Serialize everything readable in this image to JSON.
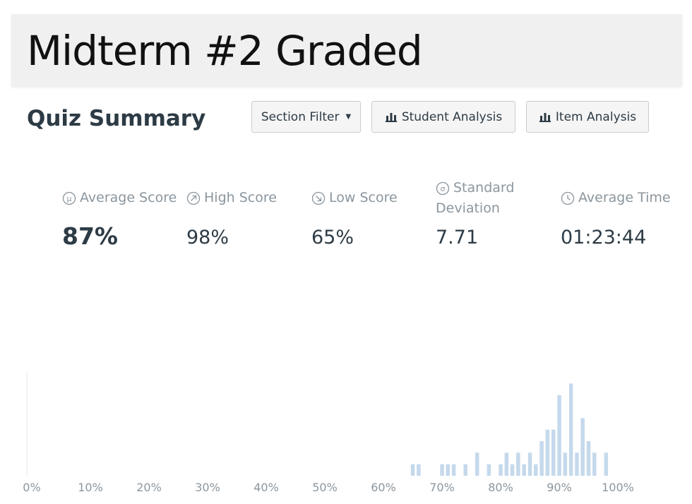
{
  "slide": {
    "title": "Midterm #2 Graded"
  },
  "quiz": {
    "heading": "Quiz Summary",
    "buttons": {
      "section_filter": "Section Filter",
      "student_analysis": "Student Analysis",
      "item_analysis": "Item Analysis"
    },
    "icons": {
      "section_filter": "caret-down-icon",
      "student_analysis": "bar-chart-icon",
      "item_analysis": "bar-chart-icon"
    }
  },
  "stats": {
    "average_score": {
      "label": "Average Score",
      "value": "87%",
      "icon": "mu-icon"
    },
    "high_score": {
      "label": "High Score",
      "value": "98%",
      "icon": "arrow-up-right-icon"
    },
    "low_score": {
      "label": "Low Score",
      "value": "65%",
      "icon": "arrow-down-right-icon"
    },
    "standard_deviation": {
      "label_line1": "Standard",
      "label_line2": "Deviation",
      "value": "7.71",
      "icon": "sigma-icon"
    },
    "average_time": {
      "label": "Average Time",
      "value": "01:23:44",
      "icon": "clock-icon"
    }
  },
  "colors": {
    "bar": "#c5d9ec",
    "text_dark": "#2d3b45",
    "text_muted": "#8b969e",
    "banner": "#f0f0f0"
  },
  "chart_data": {
    "type": "bar",
    "xlabel": "",
    "ylabel": "",
    "xlim": [
      0,
      100
    ],
    "ylim": [
      0,
      9
    ],
    "x_ticks": [
      "0%",
      "10%",
      "20%",
      "30%",
      "40%",
      "50%",
      "60%",
      "70%",
      "80%",
      "90%",
      "100%"
    ],
    "grid": false,
    "x": [
      65,
      66,
      70,
      71,
      72,
      74,
      76,
      78,
      80,
      81,
      82,
      83,
      84,
      85,
      86,
      87,
      88,
      89,
      90,
      91,
      92,
      93,
      94,
      95,
      96,
      98
    ],
    "values": [
      1,
      1,
      1,
      1,
      1,
      1,
      2,
      1,
      1,
      2,
      1,
      2,
      1,
      2,
      1,
      3,
      4,
      4,
      7,
      2,
      8,
      2,
      5,
      3,
      2,
      2
    ]
  }
}
